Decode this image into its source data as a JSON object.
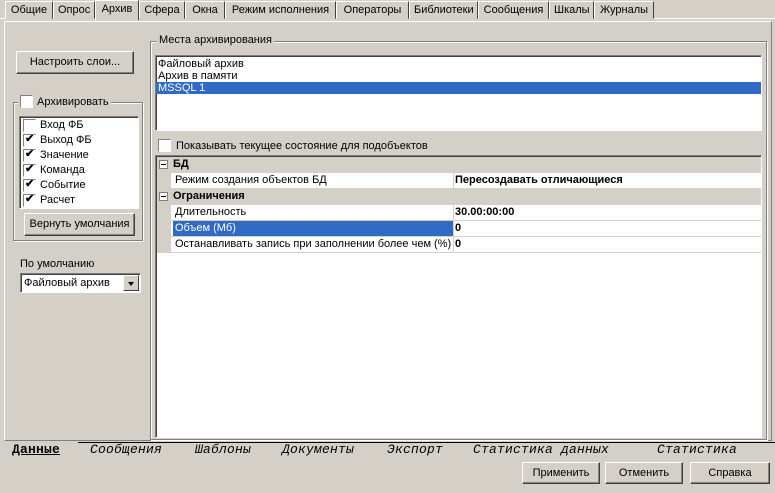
{
  "top_tabs": [
    {
      "label": "Общие",
      "active": false
    },
    {
      "label": "Опрос",
      "active": false
    },
    {
      "label": "Архив",
      "active": true
    },
    {
      "label": "Сфера",
      "active": false
    },
    {
      "label": "Окна",
      "active": false
    },
    {
      "label": "Режим исполнения",
      "active": false
    },
    {
      "label": "Операторы",
      "active": false
    },
    {
      "label": "Библиотеки",
      "active": false
    },
    {
      "label": "Сообщения",
      "active": false
    },
    {
      "label": "Шкалы",
      "active": false
    },
    {
      "label": "Журналы",
      "active": false
    }
  ],
  "left": {
    "configure_layers_button": "Настроить слои...",
    "archive_group": {
      "label": "Архивировать",
      "checked": false,
      "items": [
        {
          "label": "Вход ФБ",
          "checked": false
        },
        {
          "label": "Выход ФБ",
          "checked": true
        },
        {
          "label": "Значение",
          "checked": true
        },
        {
          "label": "Команда",
          "checked": true
        },
        {
          "label": "Событие",
          "checked": true
        },
        {
          "label": "Расчет",
          "checked": true
        }
      ],
      "reset_button": "Вернуть умолчания"
    },
    "default_label": "По умолчанию",
    "default_value": "Файловый архив"
  },
  "right": {
    "group_label": "Места архивирования",
    "locations": [
      {
        "label": "Файловый архив",
        "selected": false
      },
      {
        "label": "Архив в памяти",
        "selected": false
      },
      {
        "label": "MSSQL 1",
        "selected": true
      }
    ],
    "show_state_checkbox": {
      "label": "Показывать текущее состояние для подобъектов",
      "checked": false
    },
    "properties": [
      {
        "type": "category",
        "name": "БД"
      },
      {
        "type": "prop",
        "name": "Режим создания объектов БД",
        "value": "Пересоздавать отличающиеся"
      },
      {
        "type": "category",
        "name": "Ограничения"
      },
      {
        "type": "prop",
        "name": "Длительность",
        "value": "30.00:00:00"
      },
      {
        "type": "prop",
        "name": "Объем (Мб)",
        "value": "0",
        "selected": true
      },
      {
        "type": "prop",
        "name": "Останавливать запись при заполнении более чем (%)",
        "value": "0"
      }
    ]
  },
  "bottom_tabs": [
    {
      "label": "Данные",
      "active": true
    },
    {
      "label": "Сообщения",
      "active": false
    },
    {
      "label": "Шаблоны",
      "active": false
    },
    {
      "label": "Документы",
      "active": false
    },
    {
      "label": "Экспорт",
      "active": false
    },
    {
      "label": "Статистика данных",
      "active": false
    },
    {
      "label": "Статистика",
      "active": false
    }
  ],
  "footer": {
    "apply": "Применить",
    "cancel": "Отменить",
    "help": "Справка"
  },
  "colors": {
    "selection": "#316ac5",
    "face": "#d4d0c8"
  }
}
